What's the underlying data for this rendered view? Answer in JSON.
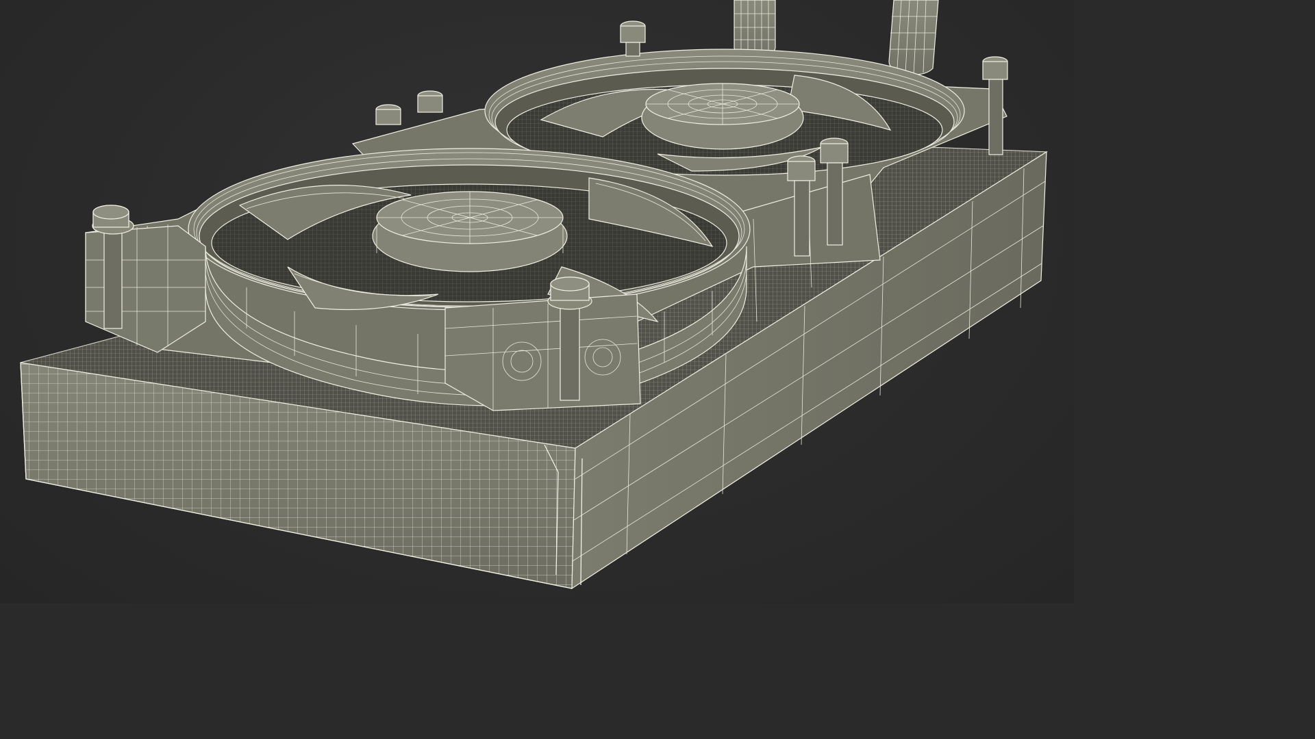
{
  "image": {
    "subject": "wireframe-3d-render",
    "colors": {
      "background": "#2b2b2b",
      "surface": "#7c7c6e",
      "surface_light": "#8c8c7e",
      "surface_dark": "#5f5f54",
      "shadow": "#3a3a36",
      "wire": "#ecece0"
    }
  }
}
